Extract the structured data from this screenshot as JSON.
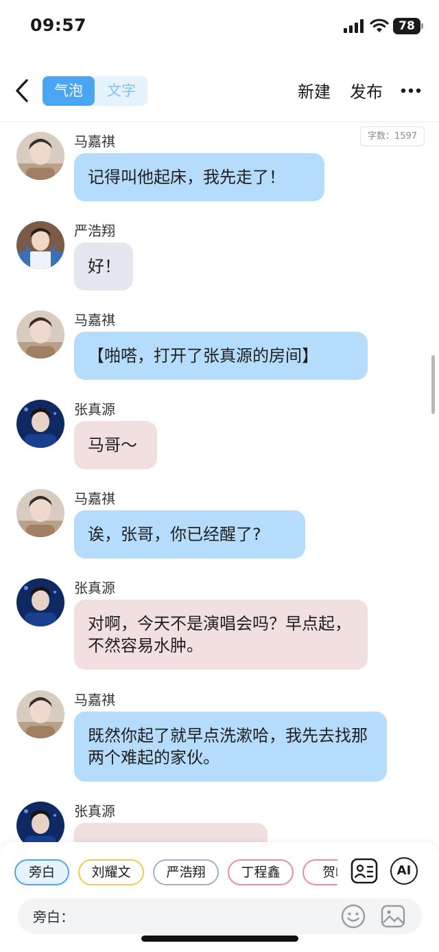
{
  "status_bar": {
    "time": "09:57",
    "battery": "78"
  },
  "nav": {
    "tabs": [
      {
        "label": "气泡",
        "active": true
      },
      {
        "label": "文字",
        "active": false
      }
    ],
    "new_label": "新建",
    "publish_label": "发布"
  },
  "word_count": "字数：1597",
  "messages": [
    {
      "sender": "马嘉祺",
      "text": "记得叫他起床，我先走了！",
      "style": "blue"
    },
    {
      "sender": "严浩翔",
      "text": "好！",
      "style": "gray"
    },
    {
      "sender": "马嘉祺",
      "text": "【啪嗒，打开了张真源的房间】",
      "style": "blue"
    },
    {
      "sender": "张真源",
      "text": "马哥～",
      "style": "pink"
    },
    {
      "sender": "马嘉祺",
      "text": "诶，张哥，你已经醒了?",
      "style": "blue"
    },
    {
      "sender": "张真源",
      "text": "对啊，今天不是演唱会吗？早点起，不然容易水肿。",
      "style": "pink"
    },
    {
      "sender": "马嘉祺",
      "text": "既然你起了就早点洗漱哈，我先去找那两个难起的家伙。",
      "style": "blue"
    },
    {
      "sender": "张真源",
      "text": "",
      "style": "pink"
    }
  ],
  "role_chips": [
    {
      "label": "旁白",
      "selected": true
    },
    {
      "label": "刘耀文",
      "selected": false
    },
    {
      "label": "严浩翔",
      "selected": false
    },
    {
      "label": "丁程鑫",
      "selected": false
    },
    {
      "label": "贺峻",
      "selected": false
    }
  ],
  "ai_label": "AI",
  "input": {
    "prefix": "旁白：",
    "value": ""
  },
  "icons": [
    "back-icon",
    "more-icon",
    "role-card-icon",
    "emoji-icon",
    "image-icon",
    "signal-icon",
    "wifi-icon"
  ],
  "colors": {
    "accent": "#4aa6f2",
    "bubble_blue": "#b5dcfa",
    "bubble_gray": "#e4e8ee",
    "bubble_pink": "#f2dfdf"
  }
}
